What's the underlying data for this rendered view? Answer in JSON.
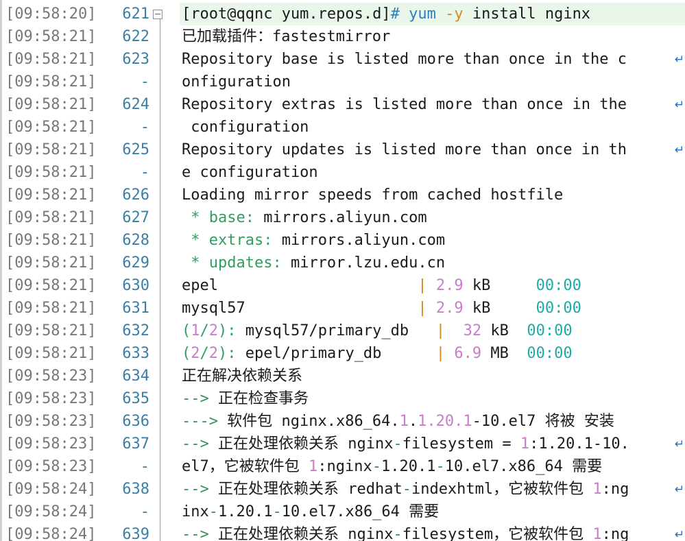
{
  "colors": {
    "plain": "#1b1b1b",
    "timestamp": "#777777",
    "line_number": "#3a7fa6",
    "prompt_keyword": "#2a7fbf",
    "flag": "#d58a1d",
    "mirror_label": "#2f9e63",
    "size_number": "#c67fc7",
    "time": "#1eaaa6",
    "arrow": "#3a8f5a",
    "version": "#c77fc8",
    "wrap_icon": "#1f6fc7",
    "current_line_bg": "#eaf6ea"
  },
  "icons": {
    "fold": "fold-collapse-icon",
    "wrap": "soft-wrap-arrow-icon"
  },
  "lines": [
    {
      "ts": "[09:58:20]",
      "ln": "621",
      "current": true,
      "fold": true,
      "wrap": false,
      "segments": [
        {
          "t": "[root@qqnc yum.repos.d]",
          "c": "pl"
        },
        {
          "t": "# yum ",
          "c": "bl"
        },
        {
          "t": "-y",
          "c": "or"
        },
        {
          "t": " install nginx",
          "c": "pl"
        }
      ]
    },
    {
      "ts": "[09:58:21]",
      "ln": "622",
      "wrap": false,
      "segments": [
        {
          "t": "已加载插件：fastestmirror",
          "c": "pl"
        }
      ]
    },
    {
      "ts": "[09:58:21]",
      "ln": "623",
      "wrap": true,
      "segments": [
        {
          "t": "Repository base is listed more than once in the c",
          "c": "pl"
        }
      ]
    },
    {
      "ts": "[09:58:21]",
      "ln": "-",
      "wrap": false,
      "segments": [
        {
          "t": "onfiguration",
          "c": "pl"
        }
      ]
    },
    {
      "ts": "[09:58:21]",
      "ln": "624",
      "wrap": true,
      "segments": [
        {
          "t": "Repository extras is listed more than once in the",
          "c": "pl"
        }
      ]
    },
    {
      "ts": "[09:58:21]",
      "ln": "-",
      "wrap": false,
      "segments": [
        {
          "t": " configuration",
          "c": "pl"
        }
      ]
    },
    {
      "ts": "[09:58:21]",
      "ln": "625",
      "wrap": true,
      "segments": [
        {
          "t": "Repository updates is listed more than once in th",
          "c": "pl"
        }
      ]
    },
    {
      "ts": "[09:58:21]",
      "ln": "-",
      "wrap": false,
      "segments": [
        {
          "t": "e configuration",
          "c": "pl"
        }
      ]
    },
    {
      "ts": "[09:58:21]",
      "ln": "626",
      "wrap": false,
      "segments": [
        {
          "t": "Loading mirror speeds from cached hostfile",
          "c": "pl"
        }
      ]
    },
    {
      "ts": "[09:58:21]",
      "ln": "627",
      "wrap": false,
      "segments": [
        {
          "t": " * base",
          "c": "gr"
        },
        {
          "t": ":",
          "c": "gr"
        },
        {
          "t": " mirrors.aliyun.com",
          "c": "pl"
        }
      ]
    },
    {
      "ts": "[09:58:21]",
      "ln": "628",
      "wrap": false,
      "segments": [
        {
          "t": " * extras",
          "c": "gr"
        },
        {
          "t": ":",
          "c": "gr"
        },
        {
          "t": " mirrors.aliyun.com",
          "c": "pl"
        }
      ]
    },
    {
      "ts": "[09:58:21]",
      "ln": "629",
      "wrap": false,
      "segments": [
        {
          "t": " * updates",
          "c": "gr"
        },
        {
          "t": ":",
          "c": "gr"
        },
        {
          "t": " mirror.lzu.edu.cn",
          "c": "pl"
        }
      ]
    },
    {
      "ts": "[09:58:21]",
      "ln": "630",
      "wrap": false,
      "segments": [
        {
          "t": "epel                      ",
          "c": "pl"
        },
        {
          "t": "| ",
          "c": "or"
        },
        {
          "t": "2.9",
          "c": "pk"
        },
        {
          "t": " kB     ",
          "c": "pl"
        },
        {
          "t": "00:00",
          "c": "cy"
        }
      ]
    },
    {
      "ts": "[09:58:21]",
      "ln": "631",
      "wrap": false,
      "segments": [
        {
          "t": "mysql57                   ",
          "c": "pl"
        },
        {
          "t": "| ",
          "c": "or"
        },
        {
          "t": "2.9",
          "c": "pk"
        },
        {
          "t": " kB     ",
          "c": "pl"
        },
        {
          "t": "00:00",
          "c": "cy"
        }
      ]
    },
    {
      "ts": "[09:58:21]",
      "ln": "632",
      "wrap": false,
      "segments": [
        {
          "t": "(",
          "c": "gr"
        },
        {
          "t": "1",
          "c": "pk"
        },
        {
          "t": "/",
          "c": "gr"
        },
        {
          "t": "2",
          "c": "pk"
        },
        {
          "t": "): ",
          "c": "gr"
        },
        {
          "t": "mysql57/primary_db   ",
          "c": "pl"
        },
        {
          "t": "|  ",
          "c": "or"
        },
        {
          "t": "32",
          "c": "pk"
        },
        {
          "t": " kB  ",
          "c": "pl"
        },
        {
          "t": "00:00",
          "c": "cy"
        }
      ]
    },
    {
      "ts": "[09:58:21]",
      "ln": "633",
      "wrap": false,
      "segments": [
        {
          "t": "(",
          "c": "gr"
        },
        {
          "t": "2",
          "c": "pk"
        },
        {
          "t": "/",
          "c": "gr"
        },
        {
          "t": "2",
          "c": "pk"
        },
        {
          "t": "): ",
          "c": "gr"
        },
        {
          "t": "epel/primary_db      ",
          "c": "pl"
        },
        {
          "t": "| ",
          "c": "or"
        },
        {
          "t": "6.9",
          "c": "pk"
        },
        {
          "t": " MB  ",
          "c": "pl"
        },
        {
          "t": "00:00",
          "c": "cy"
        }
      ]
    },
    {
      "ts": "[09:58:23]",
      "ln": "634",
      "wrap": false,
      "segments": [
        {
          "t": "正在解决依赖关系",
          "c": "pl"
        }
      ]
    },
    {
      "ts": "[09:58:23]",
      "ln": "635",
      "wrap": false,
      "segments": [
        {
          "t": "--> ",
          "c": "dg"
        },
        {
          "t": "正在检查事务",
          "c": "pl"
        }
      ]
    },
    {
      "ts": "[09:58:23]",
      "ln": "636",
      "wrap": false,
      "segments": [
        {
          "t": "---> ",
          "c": "dg"
        },
        {
          "t": "软件包 nginx.x86_64.",
          "c": "pl"
        },
        {
          "t": "1",
          "c": "pk"
        },
        {
          "t": ".",
          "c": "pl"
        },
        {
          "t": "1.20.1",
          "c": "pk"
        },
        {
          "t": "-10.el7 将被 安装",
          "c": "pl"
        }
      ]
    },
    {
      "ts": "[09:58:23]",
      "ln": "637",
      "wrap": true,
      "segments": [
        {
          "t": "--> ",
          "c": "dg"
        },
        {
          "t": "正在处理依赖关系 nginx",
          "c": "pl"
        },
        {
          "t": "-",
          "c": "dg"
        },
        {
          "t": "filesystem = ",
          "c": "pl"
        },
        {
          "t": "1",
          "c": "pk"
        },
        {
          "t": ":1.20.1-10.",
          "c": "pl"
        }
      ]
    },
    {
      "ts": "[09:58:23]",
      "ln": "-",
      "wrap": false,
      "segments": [
        {
          "t": "el7，它被软件包 ",
          "c": "pl"
        },
        {
          "t": "1",
          "c": "pk"
        },
        {
          "t": ":nginx",
          "c": "pl"
        },
        {
          "t": "-",
          "c": "dg"
        },
        {
          "t": "1.20.1",
          "c": "pl"
        },
        {
          "t": "-",
          "c": "dg"
        },
        {
          "t": "10.el7.x86_64 需要",
          "c": "pl"
        }
      ]
    },
    {
      "ts": "[09:58:24]",
      "ln": "638",
      "wrap": true,
      "segments": [
        {
          "t": "--> ",
          "c": "dg"
        },
        {
          "t": "正在处理依赖关系 redhat",
          "c": "pl"
        },
        {
          "t": "-",
          "c": "dg"
        },
        {
          "t": "indexhtml，它被软件包 ",
          "c": "pl"
        },
        {
          "t": "1",
          "c": "pk"
        },
        {
          "t": ":ng",
          "c": "pl"
        }
      ]
    },
    {
      "ts": "[09:58:24]",
      "ln": "-",
      "wrap": false,
      "segments": [
        {
          "t": "inx",
          "c": "pl"
        },
        {
          "t": "-",
          "c": "dg"
        },
        {
          "t": "1.20.1",
          "c": "pl"
        },
        {
          "t": "-",
          "c": "dg"
        },
        {
          "t": "10.el7.x86_64 需要",
          "c": "pl"
        }
      ]
    },
    {
      "ts": "[09:58:24]",
      "ln": "639",
      "wrap": true,
      "segments": [
        {
          "t": "--> ",
          "c": "dg"
        },
        {
          "t": "正在处理依赖关系 nginx",
          "c": "pl"
        },
        {
          "t": "-",
          "c": "dg"
        },
        {
          "t": "filesystem，它被软件包 ",
          "c": "pl"
        },
        {
          "t": "1",
          "c": "pk"
        },
        {
          "t": ":ng",
          "c": "pl"
        }
      ]
    }
  ]
}
